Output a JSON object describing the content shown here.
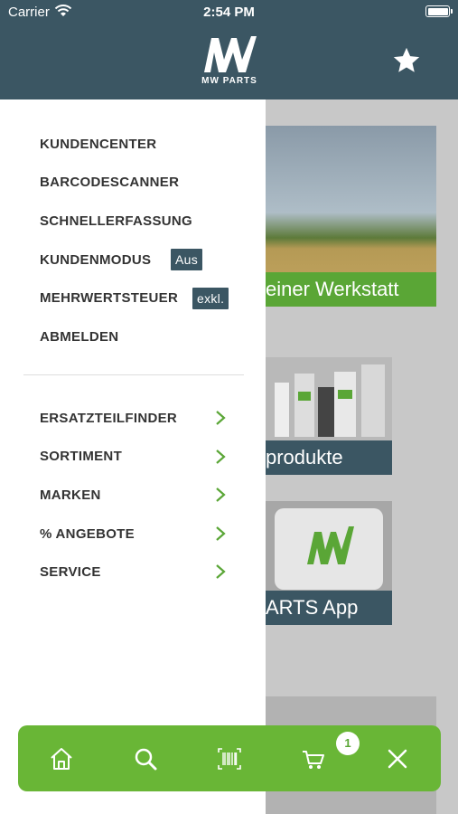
{
  "status_bar": {
    "carrier": "Carrier",
    "time": "2:54 PM"
  },
  "header": {
    "logo_text": "MW PARTS",
    "logo_icon": "mw-logo-icon",
    "favorite_icon": "star-icon"
  },
  "background": {
    "card1_caption": "einer Werkstatt",
    "card2_caption": "produkte",
    "card3_caption": "ARTS App"
  },
  "menu": {
    "top_items": [
      {
        "label": "KUNDENCENTER"
      },
      {
        "label": "BARCODESCANNER"
      },
      {
        "label": "SCHNELLERFASSUNG"
      },
      {
        "label": "KUNDENMODUS",
        "tag": "Aus"
      },
      {
        "label": "MEHRWERTSTEUER",
        "tag": "exkl."
      },
      {
        "label": "ABMELDEN"
      }
    ],
    "bottom_items": [
      {
        "label": "ERSATZTEILFINDER"
      },
      {
        "label": "SORTIMENT"
      },
      {
        "label": "MARKEN"
      },
      {
        "label": "% ANGEBOTE"
      },
      {
        "label": "SERVICE"
      }
    ]
  },
  "bottom_bar": {
    "icons": [
      "home-icon",
      "search-icon",
      "barcode-icon",
      "cart-icon",
      "close-icon"
    ],
    "cart_count": "1"
  },
  "colors": {
    "header": "#3b5663",
    "accent": "#69b636"
  }
}
